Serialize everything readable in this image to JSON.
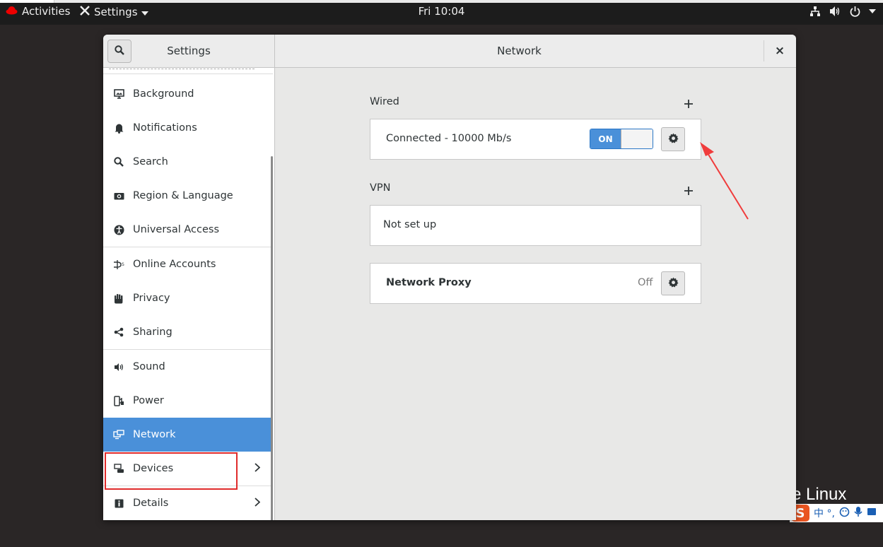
{
  "topbar": {
    "activities": "Activities",
    "app_name": "Settings",
    "clock": "Fri 10:04"
  },
  "window": {
    "sidebar_title": "Settings",
    "title": "Network",
    "close_glyph": "×"
  },
  "sidebar": {
    "items": [
      {
        "label": "Background",
        "icon": "background-icon"
      },
      {
        "label": "Notifications",
        "icon": "bell-icon"
      },
      {
        "label": "Search",
        "icon": "search-icon"
      },
      {
        "label": "Region & Language",
        "icon": "camera-icon"
      },
      {
        "label": "Universal Access",
        "icon": "accessibility-icon"
      },
      {
        "label": "Online Accounts",
        "icon": "online-accounts-icon"
      },
      {
        "label": "Privacy",
        "icon": "hand-icon"
      },
      {
        "label": "Sharing",
        "icon": "share-icon"
      },
      {
        "label": "Sound",
        "icon": "speaker-icon"
      },
      {
        "label": "Power",
        "icon": "power-plug-icon"
      },
      {
        "label": "Network",
        "icon": "network-icon",
        "active": true
      },
      {
        "label": "Devices",
        "icon": "devices-icon"
      },
      {
        "label": "Details",
        "icon": "info-icon"
      }
    ]
  },
  "network": {
    "wired": {
      "label": "Wired",
      "status": "Connected - 10000 Mb/s",
      "toggle": "ON"
    },
    "vpn": {
      "label": "VPN",
      "status": "Not set up"
    },
    "proxy": {
      "label": "Network Proxy",
      "status": "Off"
    }
  },
  "desktop": {
    "wallpaper_text": "e Linux",
    "ime_chars": "中 °,"
  },
  "colors": {
    "accent": "#4a90d9",
    "highlight_box": "#e02b2b"
  }
}
